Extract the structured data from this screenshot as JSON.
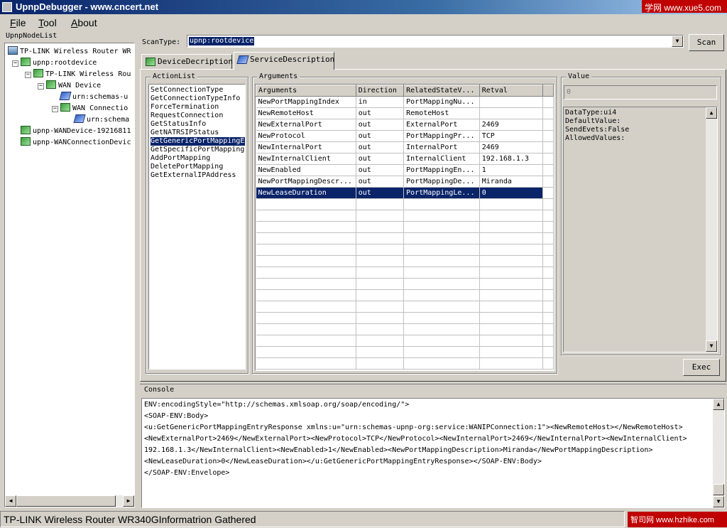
{
  "window": {
    "title": "UpnpDebugger - www.cncert.net",
    "watermark_top": "学网 www.xue5.com"
  },
  "menu": [
    "File",
    "Tool",
    "About"
  ],
  "node_list": {
    "title": "UpnpNodeList",
    "nodes": [
      "TP-LINK Wireless Router WR",
      "upnp:rootdevice",
      "TP-LINK Wireless Rou",
      "WAN Device",
      "urn:schemas-u",
      "WAN Connectio",
      "urn:schema",
      "upnp-WANDevice-19216811",
      "upnp-WANConnectionDevic"
    ]
  },
  "scan": {
    "label": "ScanType:",
    "value": "upnp:rootdevice",
    "button": "Scan"
  },
  "tabs": [
    "DeviceDecription",
    "ServiceDescription"
  ],
  "action_list": {
    "title": "ActionList",
    "items": [
      "SetConnectionType",
      "GetConnectionTypeInfo",
      "ForceTermination",
      "RequestConnection",
      "GetStatusInfo",
      "GetNATRSIPStatus",
      "GetGenericPortMappingE",
      "GetSpecificPortMapping",
      "AddPortMapping",
      "DeletePortMapping",
      "GetExternalIPAddress"
    ],
    "selected_index": 6
  },
  "arguments": {
    "title": "Arguments",
    "columns": [
      "Arguments",
      "Direction",
      "RelatedStateV...",
      "Retval"
    ],
    "rows": [
      [
        "NewPortMappingIndex",
        "in",
        "PortMappingNu...",
        ""
      ],
      [
        "NewRemoteHost",
        "out",
        "RemoteHost",
        ""
      ],
      [
        "NewExternalPort",
        "out",
        "ExternalPort",
        "2469"
      ],
      [
        "NewProtocol",
        "out",
        "PortMappingPr...",
        "TCP"
      ],
      [
        "NewInternalPort",
        "out",
        "InternalPort",
        "2469"
      ],
      [
        "NewInternalClient",
        "out",
        "InternalClient",
        "192.168.1.3"
      ],
      [
        "NewEnabled",
        "out",
        "PortMappingEn...",
        "1"
      ],
      [
        "NewPortMappingDescr...",
        "out",
        "PortMappingDe...",
        "Miranda"
      ],
      [
        "NewLeaseDuration",
        "out",
        "PortMappingLe...",
        "0"
      ]
    ],
    "selected_index": 8
  },
  "value": {
    "title": "Value",
    "input_value": "0",
    "details": [
      "DataType:ui4",
      "DefaultValue:",
      "SendEvets:False",
      "AllowedValues:"
    ],
    "exec_button": "Exec"
  },
  "console": {
    "title": "Console",
    "lines": [
      "ENV:encodingStyle=\"http://schemas.xmlsoap.org/soap/encoding/\">",
      "<SOAP-ENV:Body>",
      "<u:GetGenericPortMappingEntryResponse xmlns:u=\"urn:schemas-upnp-org:service:WANIPConnection:1\"><NewRemoteHost></NewRemoteHost>",
      "<NewExternalPort>2469</NewExternalPort><NewProtocol>TCP</NewProtocol><NewInternalPort>2469</NewInternalPort><NewInternalClient>",
      "192.168.1.3</NewInternalClient><NewEnabled>1</NewEnabled><NewPortMappingDescription>Miranda</NewPortMappingDescription>",
      "<NewLeaseDuration>0</NewLeaseDuration></u:GetGenericPortMappingEntryResponse></SOAP-ENV:Body>",
      "</SOAP-ENV:Envelope>"
    ]
  },
  "status": {
    "text": "TP-LINK Wireless Router WR340GInformatrion Gathered",
    "watermark_bottom": "智司网 www.hzhike.com"
  }
}
